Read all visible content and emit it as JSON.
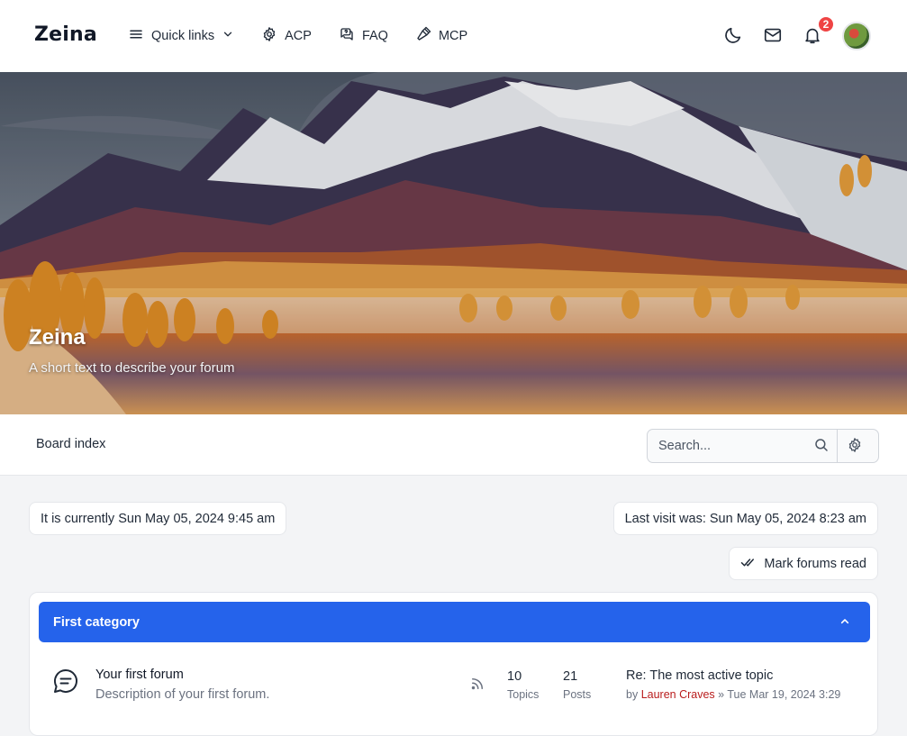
{
  "header": {
    "logo": "Zeina",
    "nav": [
      {
        "label": "Quick links",
        "icon": "menu-icon"
      },
      {
        "label": "ACP",
        "icon": "gear-icon"
      },
      {
        "label": "FAQ",
        "icon": "faq-chat-icon"
      },
      {
        "label": "MCP",
        "icon": "hammer-icon"
      }
    ],
    "notification_count": "2"
  },
  "hero": {
    "title": "Zeina",
    "subtitle": "A short text to describe your forum"
  },
  "breadcrumb": {
    "board_index": "Board index"
  },
  "search": {
    "placeholder": "Search..."
  },
  "info": {
    "current_time": "It is currently Sun May 05, 2024 9:45 am",
    "last_visit": "Last visit was: Sun May 05, 2024 8:23 am",
    "mark_read": "Mark forums read"
  },
  "category": {
    "title": "First category",
    "forums": [
      {
        "title": "Your first forum",
        "description": "Description of your first forum.",
        "topics": "10",
        "topics_label": "Topics",
        "posts": "21",
        "posts_label": "Posts",
        "last_post_title": "Re: The most active topic",
        "last_post_by": "by",
        "last_post_user": "Lauren Craves",
        "last_post_date": "» Tue Mar 19, 2024 3:29"
      }
    ]
  },
  "colors": {
    "accent": "#2563eb",
    "badge": "#ef4444",
    "username": "#b91c1c"
  }
}
